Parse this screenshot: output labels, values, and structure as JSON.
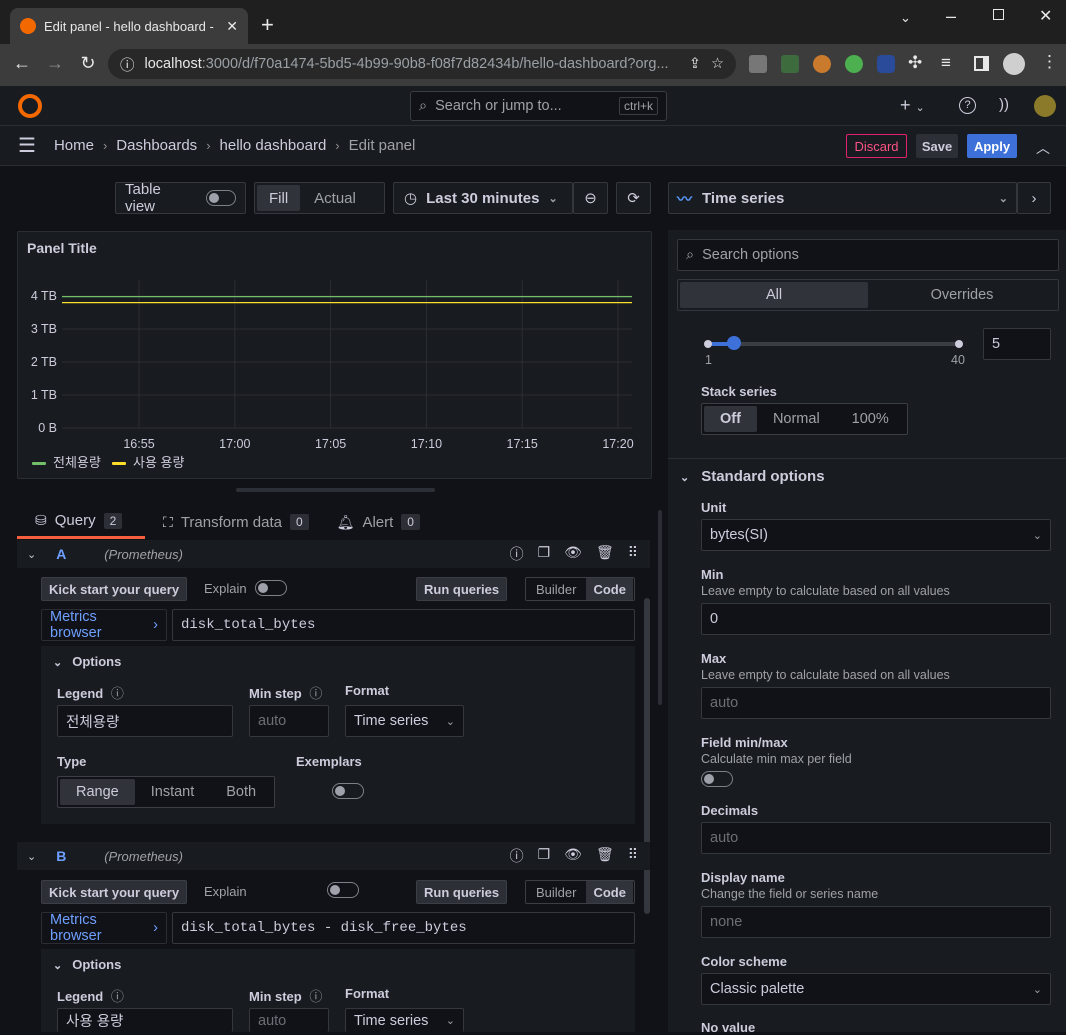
{
  "browser": {
    "tab_title": "Edit panel - hello dashboard - ",
    "url_host": "localhost",
    "url_rest": ":3000/d/f70a1474-5bd5-4b99-90b8-f08f7d82434b/hello-dashboard?org..."
  },
  "topbar": {
    "search_placeholder": "Search or jump to...",
    "search_shortcut": "ctrl+k"
  },
  "breadcrumb": [
    "Home",
    "Dashboards",
    "hello dashboard",
    "Edit panel"
  ],
  "actions": {
    "discard": "Discard",
    "save": "Save",
    "apply": "Apply"
  },
  "toolbar": {
    "table_view": "Table view",
    "fill": "Fill",
    "actual": "Actual",
    "time_range": "Last 30 minutes"
  },
  "viz_picker": {
    "label": "Time series"
  },
  "panel": {
    "title": "Panel Title"
  },
  "chart_data": {
    "type": "line",
    "x": [
      "16:55",
      "17:00",
      "17:05",
      "17:10",
      "17:15",
      "17:20"
    ],
    "y_ticks": [
      "4 TB",
      "3 TB",
      "2 TB",
      "1 TB",
      "0 B"
    ],
    "ylim": [
      0,
      4
    ],
    "series": [
      {
        "name": "전체용량",
        "color": "#73bf69",
        "values": [
          3.98,
          3.98,
          3.98,
          3.98,
          3.98,
          3.98
        ]
      },
      {
        "name": "사용 용량",
        "color": "#fade2a",
        "values": [
          3.8,
          3.8,
          3.8,
          3.8,
          3.8,
          3.8
        ]
      }
    ]
  },
  "query_tabs": [
    {
      "label": "Query",
      "count": "2"
    },
    {
      "label": "Transform data",
      "count": "0"
    },
    {
      "label": "Alert",
      "count": "0"
    }
  ],
  "queries": [
    {
      "ref": "A",
      "datasource": "(Prometheus)",
      "kick": "Kick start your query",
      "explain": "Explain",
      "run": "Run queries",
      "builder": "Builder",
      "code": "Code",
      "metrics_browser": "Metrics browser",
      "expr": "disk_total_bytes",
      "options": "Options",
      "legend_label": "Legend",
      "legend_value": "전체용량",
      "minstep_label": "Min step",
      "minstep_placeholder": "auto",
      "format_label": "Format",
      "format_value": "Time series",
      "type_label": "Type",
      "type_options": [
        "Range",
        "Instant",
        "Both"
      ],
      "exemplars_label": "Exemplars"
    },
    {
      "ref": "B",
      "datasource": "(Prometheus)",
      "kick": "Kick start your query",
      "explain": "Explain",
      "run": "Run queries",
      "builder": "Builder",
      "code": "Code",
      "metrics_browser": "Metrics browser",
      "expr": "disk_total_bytes - disk_free_bytes",
      "options": "Options",
      "legend_label": "Legend",
      "legend_value": "사용 용량",
      "minstep_label": "Min step",
      "minstep_placeholder": "auto",
      "format_label": "Format",
      "format_value": "Time series"
    }
  ],
  "options_pane": {
    "search_placeholder": "Search options",
    "tabs": [
      "All",
      "Overrides"
    ],
    "slider": {
      "min": "1",
      "max": "40",
      "value": "5",
      "fraction": 0.103
    },
    "stack_series": {
      "label": "Stack series",
      "options": [
        "Off",
        "Normal",
        "100%"
      ]
    },
    "standard_options": "Standard options",
    "unit": {
      "label": "Unit",
      "value": "bytes(SI)"
    },
    "min": {
      "label": "Min",
      "desc": "Leave empty to calculate based on all values",
      "value": "0"
    },
    "max": {
      "label": "Max",
      "desc": "Leave empty to calculate based on all values",
      "placeholder": "auto"
    },
    "field_minmax": {
      "label": "Field min/max",
      "desc": "Calculate min max per field"
    },
    "decimals": {
      "label": "Decimals",
      "placeholder": "auto"
    },
    "display_name": {
      "label": "Display name",
      "desc": "Change the field or series name",
      "placeholder": "none"
    },
    "color_scheme": {
      "label": "Color scheme",
      "value": "Classic palette"
    },
    "no_value": {
      "label": "No value"
    }
  }
}
